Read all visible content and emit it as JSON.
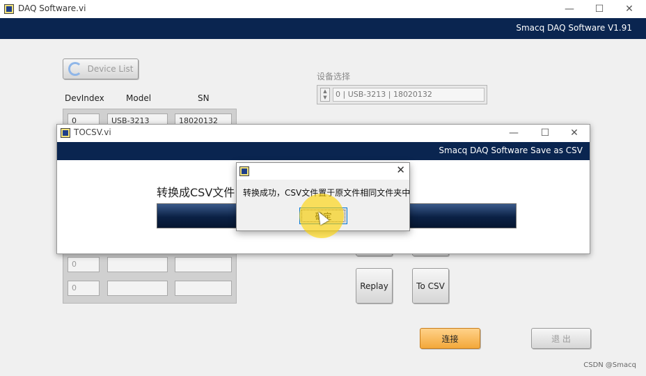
{
  "main_window": {
    "title": "DAQ Software.vi",
    "header": "Smacq DAQ Software V1.91",
    "controls": {
      "minimize": "—",
      "maximize": "☐",
      "close": "✕"
    }
  },
  "device_list_button": "Device List",
  "table": {
    "headers": [
      "DevIndex",
      "Model",
      "SN"
    ],
    "rows": [
      [
        "0",
        "USB-3213",
        "18020132"
      ],
      [
        "0",
        "",
        ""
      ],
      [
        "0",
        "",
        ""
      ]
    ]
  },
  "device_select": {
    "label": "设备选择",
    "value": "0 | USB-3213 | 18020132"
  },
  "buttons": {
    "replay": "Replay",
    "to_csv": "To CSV",
    "connect": "连接",
    "exit": "退 出"
  },
  "tocsv_window": {
    "title": "TOCSV.vi",
    "header": "Smacq DAQ Software Save as CSV",
    "label": "转换成CSV文件",
    "controls": {
      "minimize": "—",
      "maximize": "☐",
      "close": "✕"
    }
  },
  "message_dialog": {
    "text": "转换成功，CSV文件置于原文件相同文件夹中",
    "ok": "确定",
    "close": "✕"
  },
  "watermark": "CSDN @Smacq",
  "colors": {
    "header_navy": "#0a2550",
    "connect_orange": "#f3a83a",
    "highlight_yellow": "#ffd400"
  }
}
